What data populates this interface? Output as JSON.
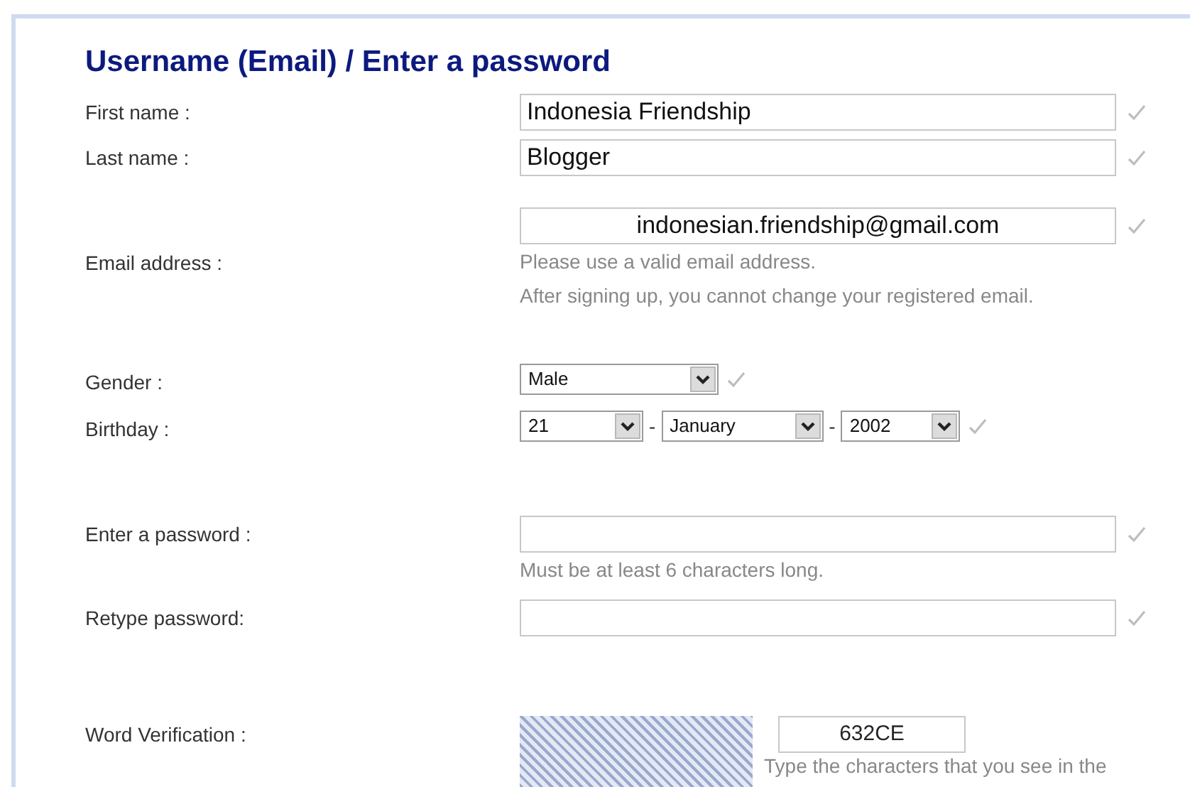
{
  "heading": "Username (Email) / Enter a password",
  "rows": [
    {
      "kind": "text",
      "label": "First name :",
      "value": "Indonesia Friendship"
    },
    {
      "kind": "text",
      "label": "Last name :",
      "value": "Blogger"
    },
    {
      "kind": "email",
      "label": "Email address :",
      "value": "indonesian.friendship@gmail.com",
      "hints": [
        "Please use a valid email address.",
        "After signing up, you cannot change your registered email."
      ]
    },
    {
      "kind": "select",
      "label": "Gender :",
      "parts": [
        {
          "kind": "select",
          "value": "Male"
        }
      ]
    },
    {
      "kind": "select",
      "label": "Birthday :",
      "parts": [
        {
          "kind": "select",
          "value": "21"
        },
        {
          "kind": "separator",
          "text": "-"
        },
        {
          "kind": "select",
          "value": "January"
        },
        {
          "kind": "separator",
          "text": "-"
        },
        {
          "kind": "select",
          "value": "2002"
        }
      ]
    },
    {
      "kind": "password",
      "label": "Enter a password :",
      "hints": [
        "Must be at least 6 characters long."
      ]
    },
    {
      "kind": "password",
      "label": "Retype password:"
    },
    {
      "kind": "captcha",
      "label": "Word Verification :",
      "value": "632CE",
      "hints": [
        "Type the characters that you see in the"
      ]
    }
  ]
}
